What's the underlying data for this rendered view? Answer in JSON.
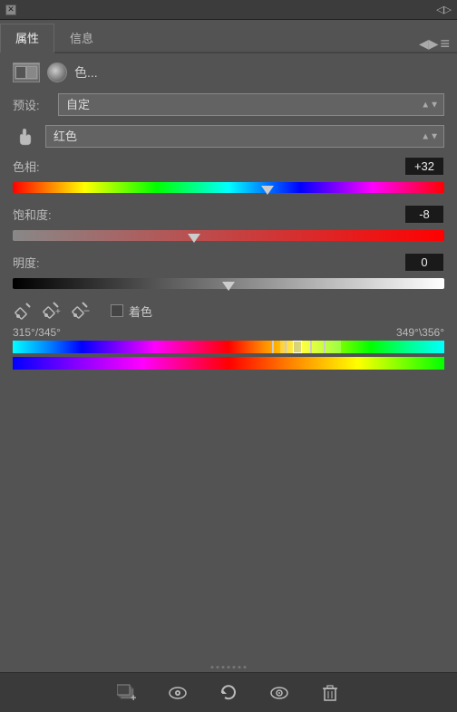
{
  "titlebar": {
    "close_label": "✕",
    "arrows_label": "◁▷"
  },
  "tabs": {
    "tab1_label": "属性",
    "tab2_label": "信息",
    "menu_icon": "≡"
  },
  "panel": {
    "title": "色...",
    "preset_label": "预设:",
    "preset_value": "自定",
    "channel_label": "",
    "channel_value": "红色",
    "hue_label": "色相:",
    "hue_value": "+32",
    "sat_label": "饱和度:",
    "sat_value": "-8",
    "light_label": "明度:",
    "light_value": "0",
    "colorize_label": "着色",
    "range_left": "315°/345°",
    "range_right": "349°\\356°"
  },
  "sliders": {
    "hue_pct": 0.59,
    "sat_pct": 0.42,
    "light_pct": 0.5
  },
  "footer": {
    "btn1_label": "⬛",
    "btn2_label": "◉",
    "btn3_label": "↺",
    "btn4_label": "👁",
    "btn5_label": "🗑"
  }
}
